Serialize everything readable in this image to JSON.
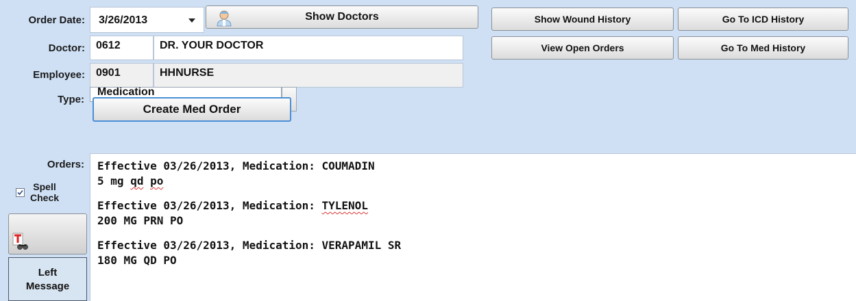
{
  "header": {
    "order_date_label": "Order Date:",
    "order_date_value": "3/26/2013",
    "doctor_label": "Doctor:",
    "doctor_code": "0612",
    "doctor_name": "DR. YOUR DOCTOR",
    "employee_label": "Employee:",
    "employee_code": "0901",
    "employee_name": "HHNURSE",
    "type_label": "Type:",
    "type_value": "Medication"
  },
  "buttons": {
    "show_doctors": "Show Doctors",
    "create_med_order": "Create Med Order",
    "show_wound_history": "Show Wound History",
    "go_to_icd_history": "Go To ICD History",
    "view_open_orders": "View Open Orders",
    "go_to_med_history": "Go To Med History",
    "left_message_line1": "Left",
    "left_message_line2": "Message"
  },
  "orders": {
    "label": "Orders:",
    "spell_check_line1": "Spell",
    "spell_check_line2": "Check",
    "spell_check_checked": true,
    "entries": [
      {
        "line1_prefix": "Effective 03/26/2013, Medication: ",
        "drug": "COUMADIN",
        "line2": "5 mg qd po"
      },
      {
        "line1_prefix": "Effective 03/26/2013, Medication: ",
        "drug": "TYLENOL",
        "line2": "200 MG PRN PO"
      },
      {
        "line1_prefix": "Effective 03/26/2013, Medication: ",
        "drug": "VERAPAMIL SR",
        "line2": "180 MG QD PO"
      }
    ]
  },
  "icons": {
    "doctor": "doctor-avatar-icon",
    "spellcheck": "spellcheck-binoculars-icon",
    "dropdown": "chevron-down-icon"
  },
  "colors": {
    "background": "#cfe0f5",
    "spell_error": "#d33"
  }
}
